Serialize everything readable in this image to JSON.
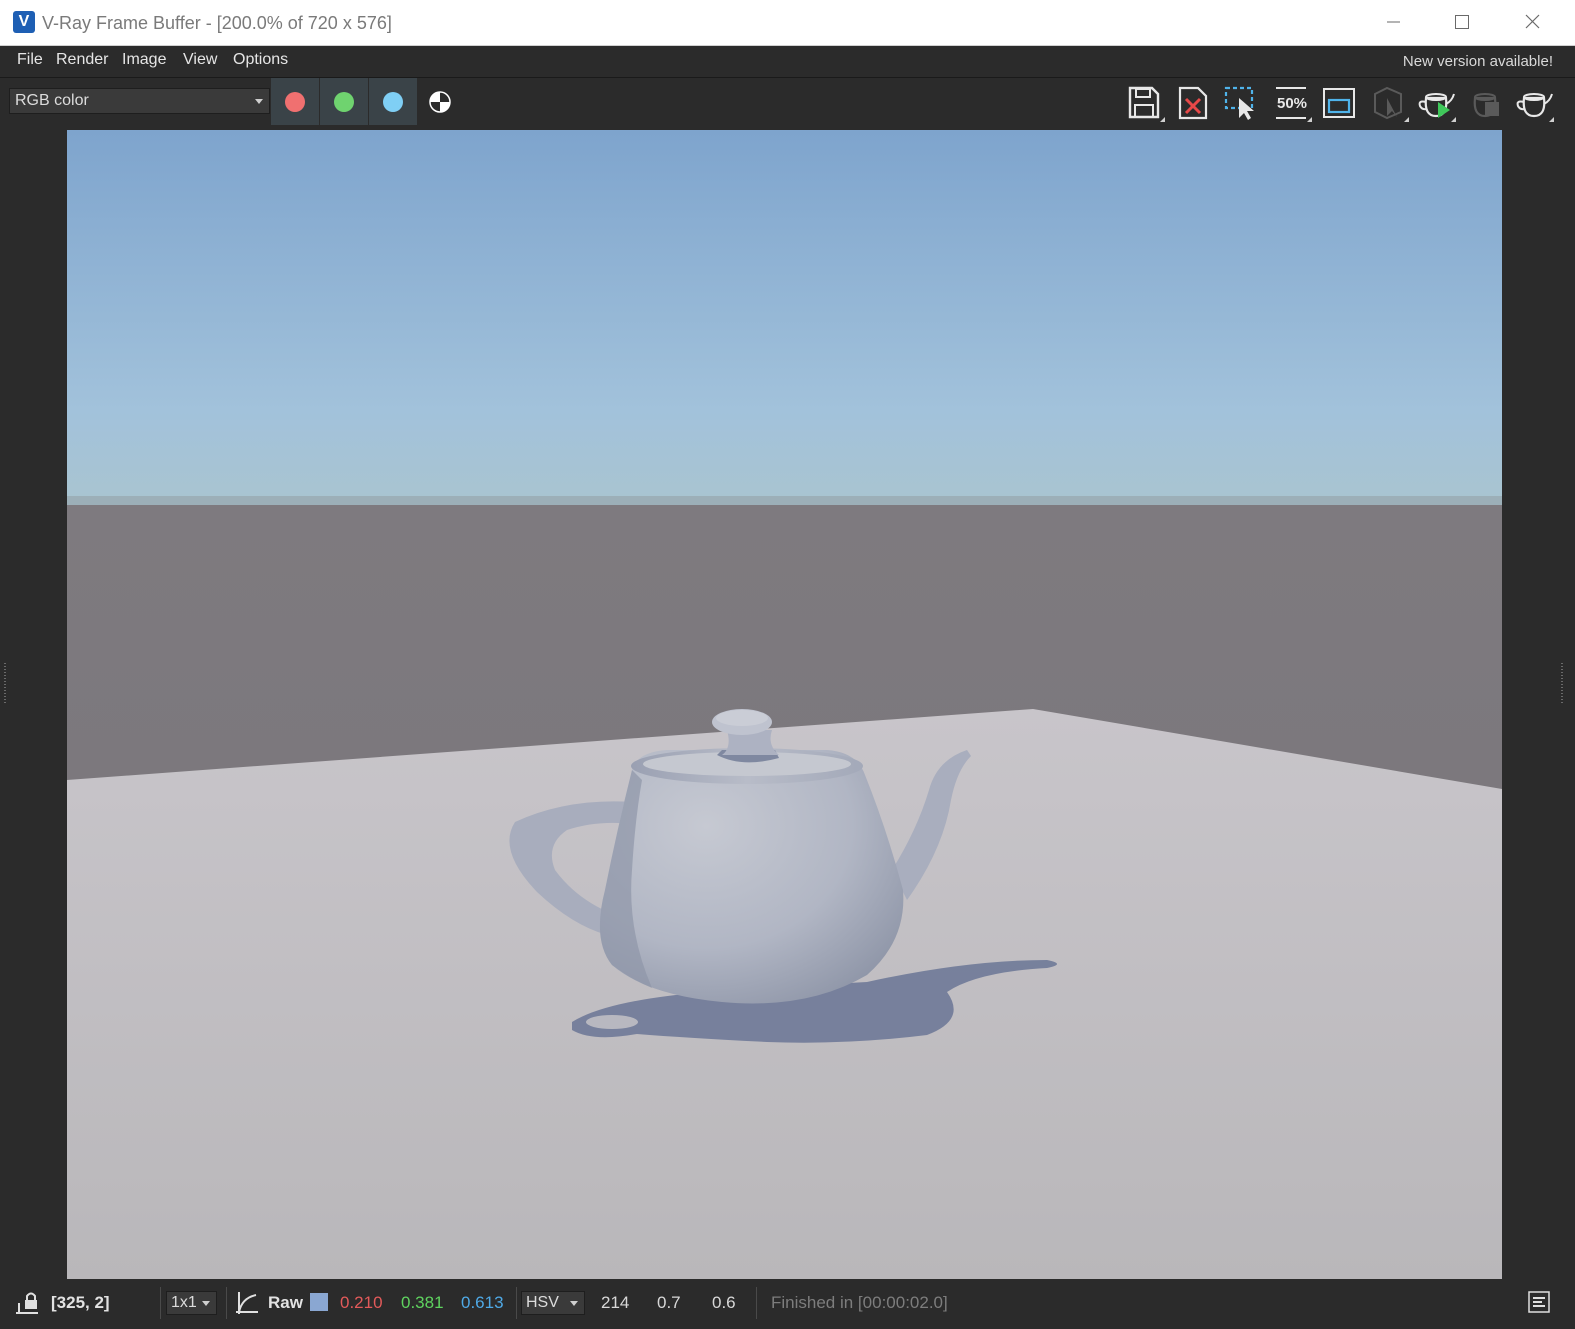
{
  "window": {
    "title": "V-Ray Frame Buffer - [200.0% of 720 x 576]",
    "app_icon_glyph": "V"
  },
  "menu": {
    "items": [
      "File",
      "Render",
      "Image",
      "View",
      "Options"
    ],
    "new_version": "New version available!"
  },
  "toolbar": {
    "channel": "RGB color",
    "channel_colors": {
      "red": "#f07070",
      "green": "#6fd36f",
      "blue": "#7fcff5"
    },
    "zoom_label": "50%",
    "icons": [
      "save-icon",
      "clear-image-icon",
      "region-select-icon",
      "zoom-50-icon",
      "frame-region-icon",
      "render-region-icon",
      "start-render-icon",
      "stop-render-icon",
      "render-icon"
    ]
  },
  "statusbar": {
    "coords": "[325, 2]",
    "sample_size": "1x1",
    "mode": "Raw",
    "swatch_color": "#8aa7d2",
    "r": "0.210",
    "g": "0.381",
    "b": "0.613",
    "color_model": "HSV",
    "h": "214",
    "s": "0.7",
    "v": "0.6",
    "status": "Finished in [00:00:02.0]"
  }
}
